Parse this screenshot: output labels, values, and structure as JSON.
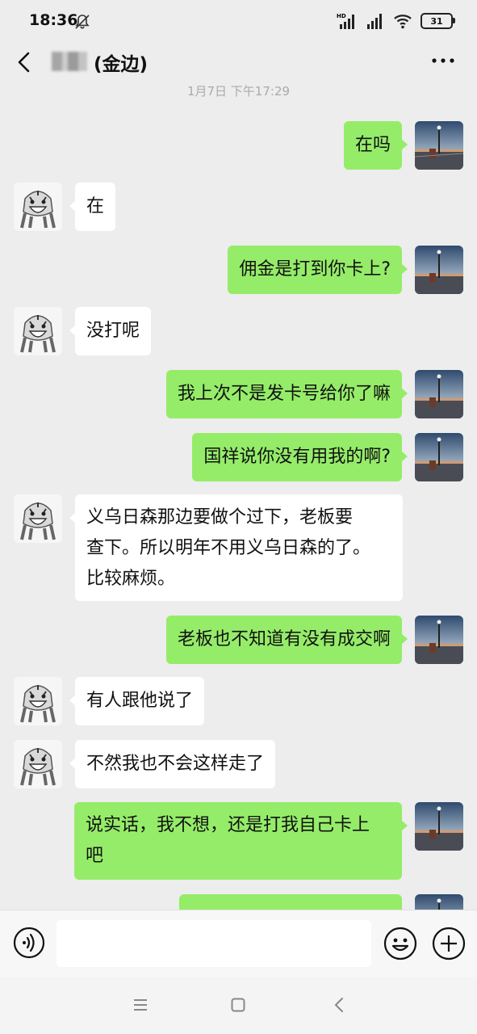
{
  "status": {
    "time": "18:36",
    "battery": "31",
    "network_hd": "HD"
  },
  "header": {
    "title": "(金边)"
  },
  "timestamp": "1月7日 下午17:29",
  "messages": [
    {
      "side": "right",
      "text": "在吗"
    },
    {
      "side": "left",
      "text": "在"
    },
    {
      "side": "right",
      "text": "佣金是打到你卡上?"
    },
    {
      "side": "left",
      "text": "没打呢"
    },
    {
      "side": "right",
      "text": "我上次不是发卡号给你了嘛"
    },
    {
      "side": "right",
      "text": "国祥说你没有用我的啊?"
    },
    {
      "side": "left",
      "text": "义乌日森那边要做个过下，老板要\n查下。所以明年不用义乌日森的了。\n比较麻烦。"
    },
    {
      "side": "right",
      "text": "老板也不知道有没有成交啊"
    },
    {
      "side": "left",
      "text": "有人跟他说了"
    },
    {
      "side": "left",
      "text": "不然我也不会这样走了"
    },
    {
      "side": "right",
      "text": "说实话，我不想，还是打我自己卡上\n吧"
    },
    {
      "side": "right",
      "text": ""
    }
  ],
  "input": {
    "value": "",
    "placeholder": ""
  },
  "icons": {
    "back": "chevron-left-icon",
    "more": "more-dots-icon",
    "voice": "voice-icon",
    "emoji": "emoji-icon",
    "plus": "plus-icon"
  },
  "colors": {
    "background": "#ededed",
    "outgoing_bubble": "#95ec69",
    "incoming_bubble": "#ffffff"
  }
}
